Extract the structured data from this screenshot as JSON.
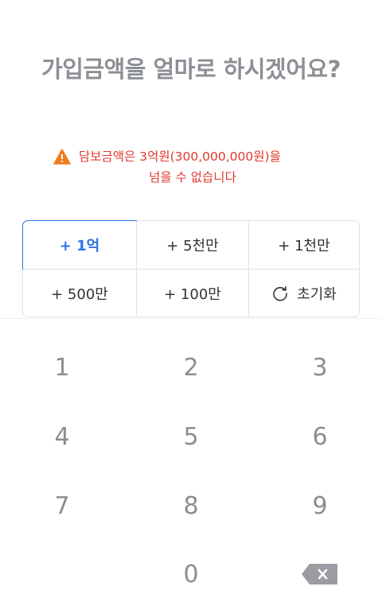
{
  "title": "가입금액을 얼마로 하시겠어요?",
  "warning": {
    "line1": "담보금액은 3억원(300,000,000원)을",
    "line2": "넘을 수 없습니다",
    "icon": "warning-icon",
    "color": "#e2382f"
  },
  "amount_buttons": [
    {
      "label": "+ 1억",
      "selected": true
    },
    {
      "label": "+ 5천만",
      "selected": false
    },
    {
      "label": "+ 1천만",
      "selected": false
    },
    {
      "label": "+ 500만",
      "selected": false
    },
    {
      "label": "+ 100만",
      "selected": false
    },
    {
      "label": "초기화",
      "icon": "reset-icon",
      "selected": false
    }
  ],
  "accent_color": "#2f74e6",
  "keypad": {
    "keys": [
      "1",
      "2",
      "3",
      "4",
      "5",
      "6",
      "7",
      "8",
      "9",
      "0"
    ],
    "backspace_icon": "backspace-icon"
  }
}
